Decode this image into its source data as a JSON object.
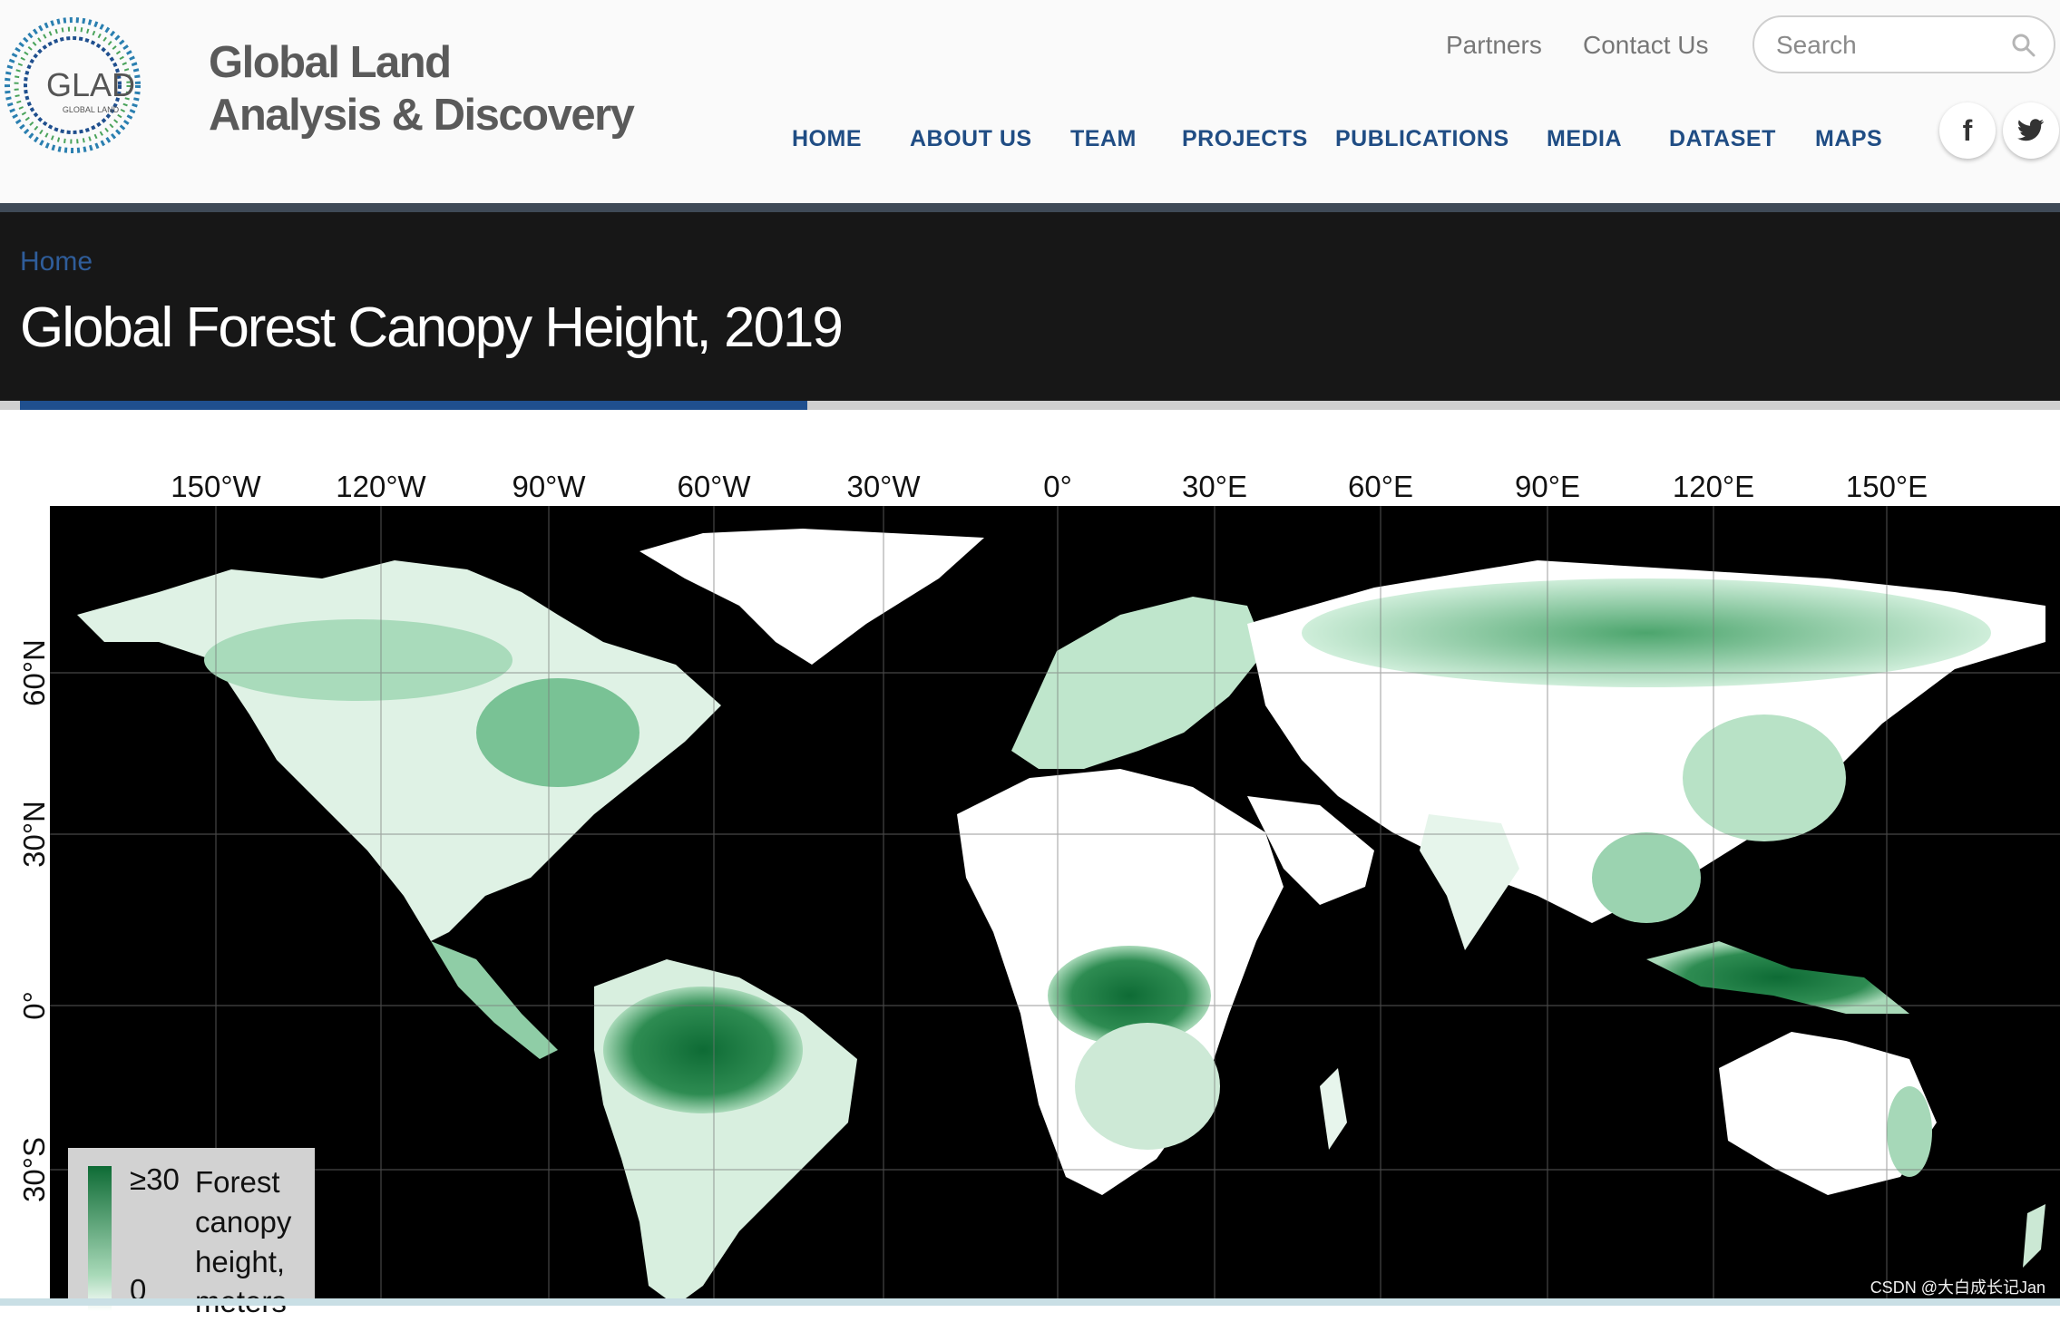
{
  "header": {
    "brand_line1": "Global Land",
    "brand_line2": "Analysis & Discovery",
    "logo_text": "GLAD",
    "logo_subtext": "GLOBAL LAND"
  },
  "top_links": [
    "Partners",
    "Contact Us"
  ],
  "search": {
    "placeholder": "Search"
  },
  "nav": [
    "HOME",
    "ABOUT US",
    "TEAM",
    "PROJECTS",
    "PUBLICATIONS",
    "MEDIA",
    "DATASET",
    "MAPS"
  ],
  "social": {
    "facebook": "f",
    "twitter": "❝"
  },
  "page": {
    "breadcrumb": "Home",
    "title": "Global Forest Canopy Height, 2019"
  },
  "map": {
    "lon_labels": [
      "150°W",
      "120°W",
      "90°W",
      "60°W",
      "30°W",
      "0°",
      "30°E",
      "60°E",
      "90°E",
      "120°E",
      "150°E"
    ],
    "lat_labels": [
      "60°N",
      "30°N",
      "0°",
      "30°S"
    ],
    "legend": {
      "max": "≥30",
      "min": "0",
      "text_line1": "Forest",
      "text_line2": "canopy",
      "text_line3": "height,",
      "text_line4": "meters"
    },
    "colors": {
      "ocean": "#000000",
      "land": "#ffffff",
      "forest_dark": "#0e6b35",
      "forest_light": "#a8d9b8"
    }
  },
  "watermark": "CSDN @大白成长记Jan"
}
